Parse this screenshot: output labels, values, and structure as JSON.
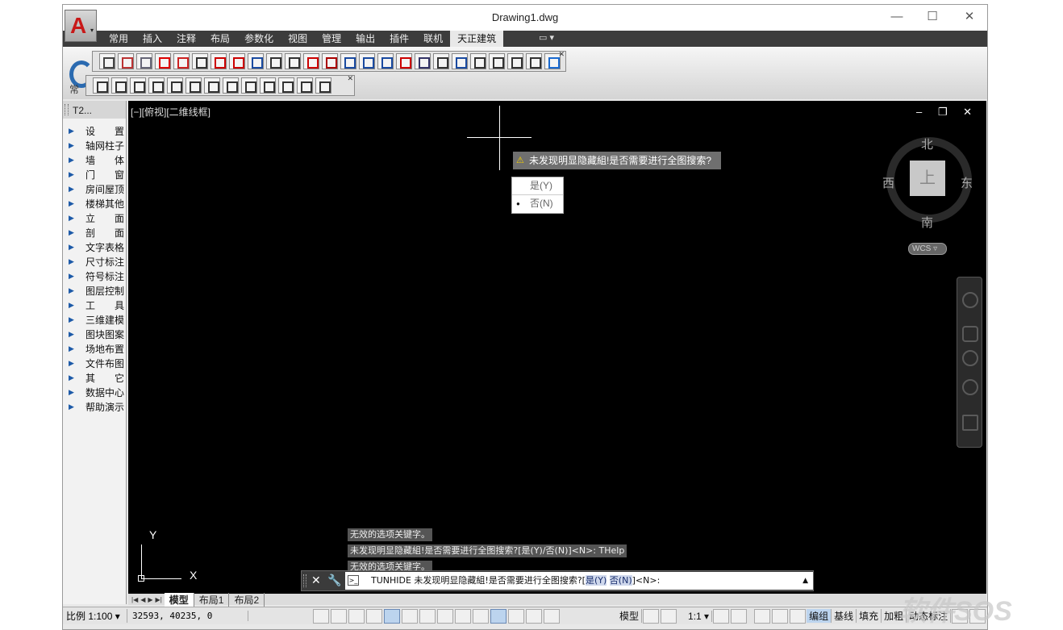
{
  "window": {
    "title": "Drawing1.dwg",
    "minimize": "—",
    "maximize": "☐",
    "close": "✕"
  },
  "app_button": {
    "logo": "A",
    "arrow": "▾"
  },
  "ribbon": {
    "tabs": [
      "常用",
      "插入",
      "注释",
      "布局",
      "参数化",
      "视图",
      "管理",
      "输出",
      "插件",
      "联机",
      "天正建筑"
    ],
    "active_tab": "天正建筑",
    "extra": "▭ ▾",
    "group_label": "常"
  },
  "palette": {
    "title": "T2...",
    "items": [
      "设　　置",
      "轴网柱子",
      "墙　　体",
      "门　　窗",
      "房间屋顶",
      "楼梯其他",
      "立　　面",
      "剖　　面",
      "文字表格",
      "尺寸标注",
      "符号标注",
      "图层控制",
      "工　　具",
      "三维建模",
      "图块图案",
      "场地布置",
      "文件布图",
      "其　　它",
      "数据中心",
      "帮助演示"
    ]
  },
  "viewport": {
    "label": "[−][俯视][二维线框]",
    "controls": "‒ ❐ ✕"
  },
  "prompt": {
    "text": "未发现明显隐藏組!是否需要进行全图搜索?",
    "warn_icon": "⚠",
    "options": [
      "是(Y)",
      "否(N)"
    ],
    "selected": "否(N)"
  },
  "viewcube": {
    "north": "北",
    "south": "南",
    "east": "东",
    "west": "西",
    "face": "上",
    "wcs": "WCS ▿"
  },
  "ucs": {
    "x": "X",
    "y": "Y"
  },
  "command_history": [
    "无效的选项关键字。",
    "未发现明显隐藏組!是否需要进行全图搜索?[是(Y)/否(N)]<N>: THelp",
    "无效的选项关键字。"
  ],
  "command_line": {
    "close": "✕",
    "prefix": "TUNHIDE 未发现明显隐藏組!是否需要进行全图搜索?[",
    "opt1": "是(Y)",
    "opt2": "否(N)",
    "suffix": "]<N>:",
    "up": "▲"
  },
  "layout_tabs": {
    "tabs": [
      "模型",
      "布局1",
      "布局2"
    ],
    "active": "模型"
  },
  "status_bar": {
    "scale": "比例 1:100 ▾",
    "coords": "32593, 40235, 0",
    "model": "模型",
    "annoscale": "1:1 ▾",
    "toggles": [
      "编组",
      "基线",
      "填充",
      "加粗",
      "动态标注"
    ],
    "active_toggle": "编组"
  },
  "watermark": "软件SOS"
}
